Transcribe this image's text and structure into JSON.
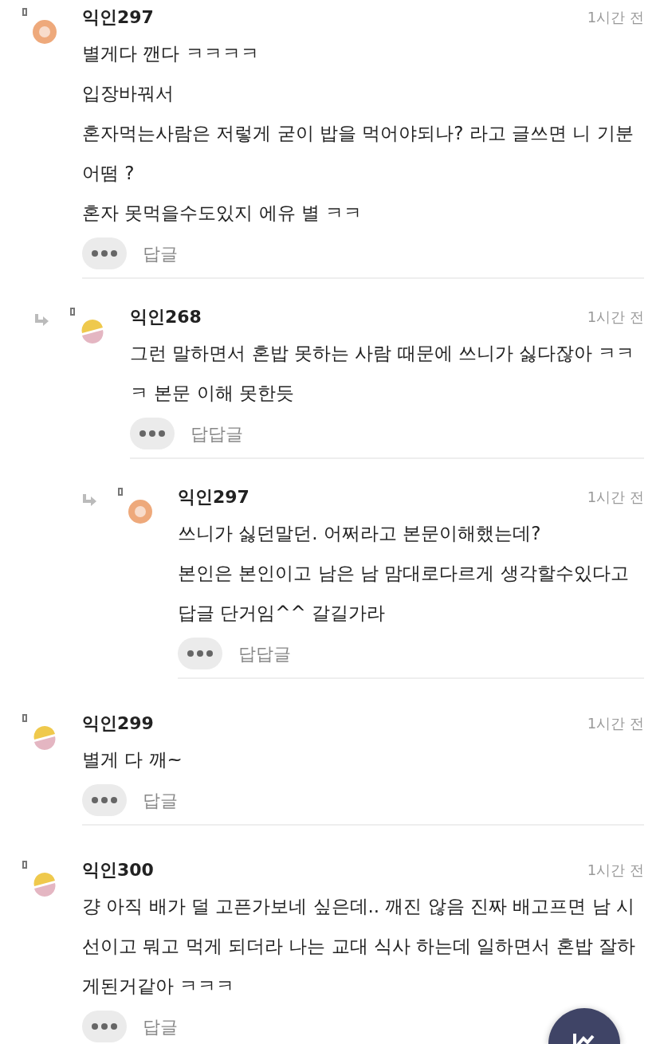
{
  "comments": [
    {
      "author": "익인297",
      "time": "1시간 전",
      "kind": "ring",
      "lines": [
        "별게다 깬다 ㅋㅋㅋㅋ",
        "입장바꿔서",
        "혼자먹는사람은 저렇게 굳이 밥을 먹어야되나? 라고 글쓰면 니 기분 어떰 ?",
        "혼자 못먹을수도있지 에유 별 ㅋㅋ"
      ],
      "reply_label": "답글",
      "children": [
        {
          "author": "익인268",
          "time": "1시간 전",
          "kind": "split",
          "lines": [
            "그런 말하면서 혼밥 못하는 사람 때문에 쓰니가 싫다잖아 ㅋㅋㅋ 본문 이해 못한듯"
          ],
          "reply_label": "답답글",
          "children": [
            {
              "author": "익인297",
              "time": "1시간 전",
              "kind": "ring",
              "lines": [
                "쓰니가 싫던말던. 어쩌라고 본문이해했는데?",
                "본인은 본인이고 남은 남 맘대로다르게 생각할수있다고 답글 단거임^^ 갈길가라"
              ],
              "reply_label": "답답글"
            }
          ]
        }
      ]
    },
    {
      "author": "익인299",
      "time": "1시간 전",
      "kind": "split",
      "lines": [
        "별게 다 깨~"
      ],
      "reply_label": "답글"
    },
    {
      "author": "익인300",
      "time": "1시간 전",
      "kind": "split",
      "lines": [
        "걍 아직 배가 덜 고픈가보네 싶은데.. 깨진 않음 진짜 배고프면 남 시선이고 뭐고 먹게 되더라 나는 교대 식사 하는데 일하면서 혼밥 잘하게된거같아 ㅋㅋㅋ"
      ],
      "reply_label": "답글"
    }
  ]
}
